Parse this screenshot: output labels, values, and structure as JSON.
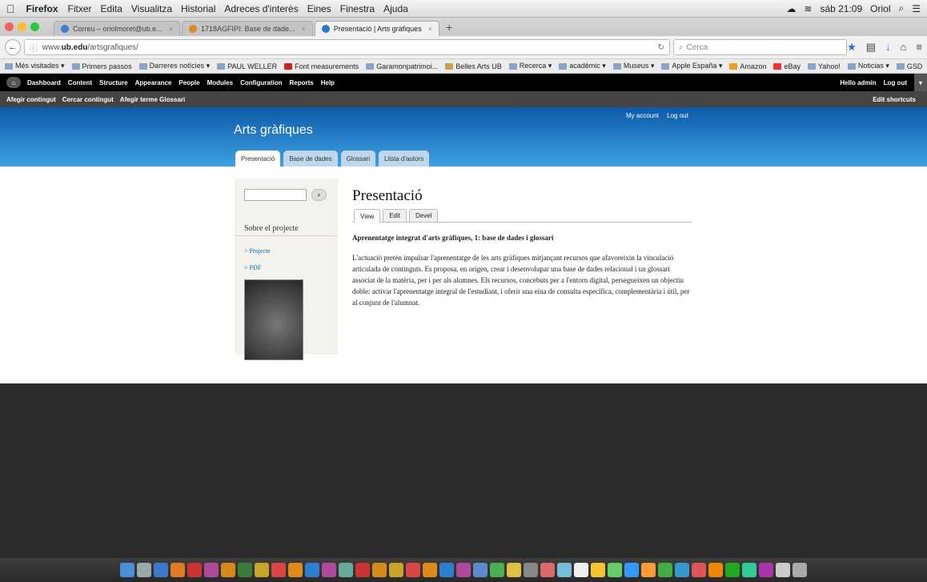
{
  "menubar": {
    "app": "Firefox",
    "items": [
      "Fitxer",
      "Edita",
      "Visualitza",
      "Historial",
      "Adreces d'interès",
      "Eines",
      "Finestra",
      "Ajuda"
    ],
    "clock": "sáb 21:09",
    "user": "Oriol"
  },
  "tabs": [
    {
      "label": "Correu – oriolmoret@ub.e...",
      "color": "#3b7fd4"
    },
    {
      "label": "1718AGFIPI: Base de dade...",
      "color": "#e08a1c"
    },
    {
      "label": "Presentació | Arts gràfiques",
      "color": "#2b78c8"
    }
  ],
  "nav": {
    "url_prefix": "www.",
    "url_domain": "ub.edu",
    "url_path": "/artsgrafiques/",
    "search_placeholder": "Cerca"
  },
  "bookmarks": [
    "Més visitades ▾",
    "Primers passos",
    "Darreres notícies ▾",
    "PAUL WELLER",
    "Font measurements",
    "Garamonpatrimoi...",
    "Belles Arts UB",
    "Recerca ▾",
    "acadèmic ▾",
    "Museus ▾",
    "Apple España ▾",
    "Amazon",
    "eBay",
    "Yahoo!",
    "Noticias ▾",
    "GSD"
  ],
  "admin": {
    "items": [
      "Dashboard",
      "Content",
      "Structure",
      "Appearance",
      "People",
      "Modules",
      "Configuration",
      "Reports",
      "Help"
    ],
    "hello": "Hello admin",
    "logout": "Log out"
  },
  "shortcuts": {
    "items": [
      "Afegir contingut",
      "Cercar contingut",
      "Afegir terme Glossari"
    ],
    "edit": "Edit shortcuts"
  },
  "site": {
    "name": "Arts gràfiques",
    "secondary": [
      "My account",
      "Log out"
    ],
    "primary_tabs": [
      "Presentació",
      "Base de dades",
      "Glossari",
      "Llista d'autors"
    ]
  },
  "sidebar": {
    "block_title": "Sobre el projecte",
    "links": [
      "> Projecte",
      "> PDF"
    ]
  },
  "content": {
    "title": "Presentació",
    "local_tabs": [
      "View",
      "Edit",
      "Devel"
    ],
    "subtitle": "Aprenentatge integrat d'arts gràfiques, 1: base de dades i glossari",
    "body": "L'actuació pretén impulsar l'aprenentatge de les arts gràfiques mitjançant recursos que afavoreixin la vinculació articulada de continguts. Es proposa, en origen, crear i desenvolupar una base de dades relacional i un glossari associat de la matèria, per i per als alumnes. Els recursos, concebuts per a l'entorn digital, persegueixen un objectiu doble: activar l'aprenentatge integral de l'estudiant, i oferir una eina de consulta específica, complementària i útil, per al conjunt de l'alumnat."
  },
  "colors": {
    "header_top": "#0d5aa8",
    "header_bottom": "#3fa0e2",
    "link": "#0068b4"
  }
}
